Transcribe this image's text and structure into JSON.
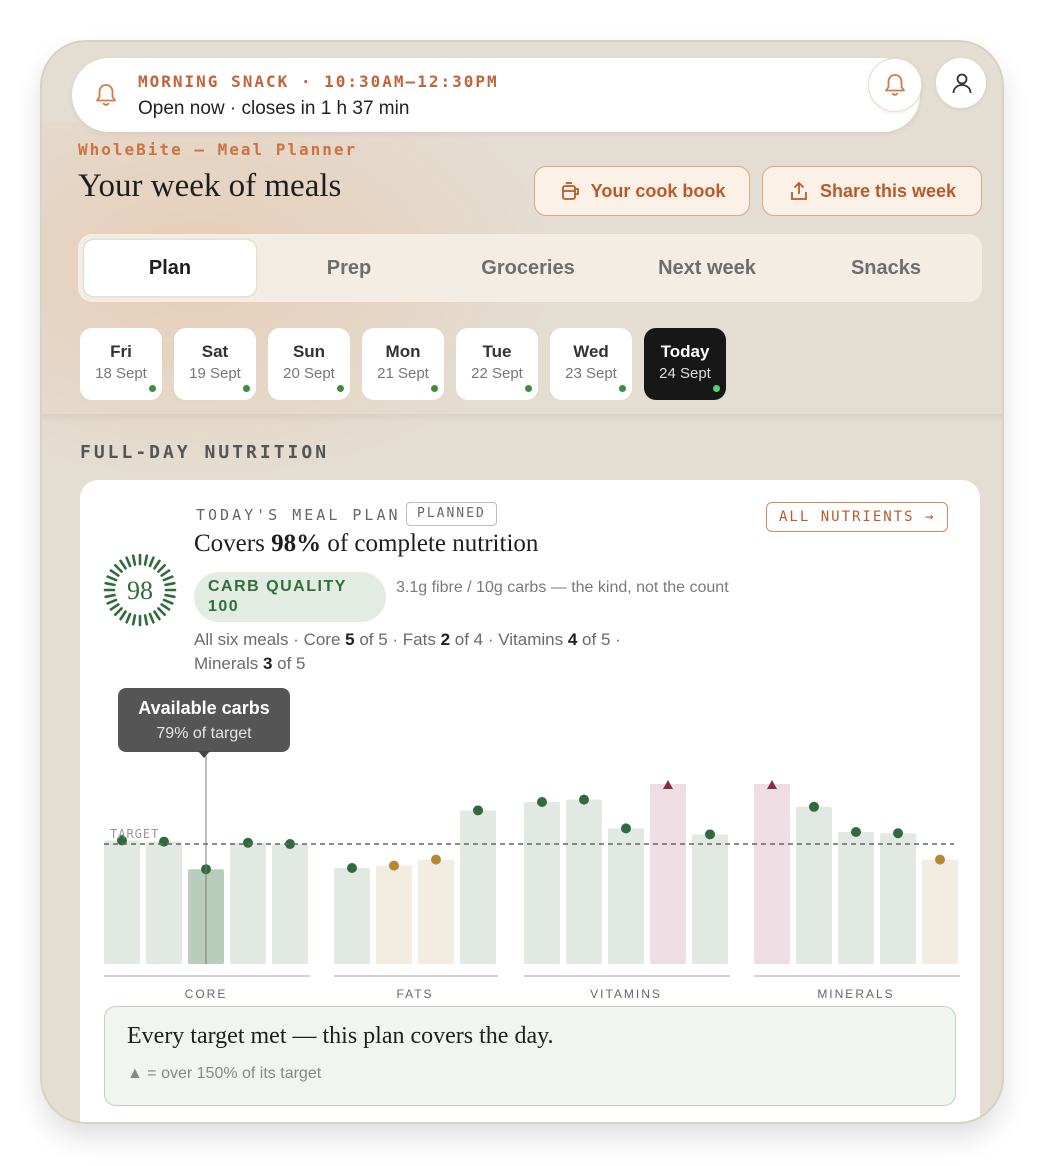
{
  "notification": {
    "title": "MORNING SNACK · 10:30AM–12:30PM",
    "subtitle": "Open now · closes in 1 h 37 min"
  },
  "header": {
    "brand": "WholeBite — Meal Planner",
    "title": "Your week of meals",
    "cookbook_label": "Your cook book",
    "share_label": "Share this week"
  },
  "tabs": [
    {
      "label": "Plan",
      "active": true
    },
    {
      "label": "Prep"
    },
    {
      "label": "Groceries"
    },
    {
      "label": "Next week"
    },
    {
      "label": "Snacks"
    }
  ],
  "days": [
    {
      "name": "Fri",
      "date": "18 Sept"
    },
    {
      "name": "Sat",
      "date": "19 Sept"
    },
    {
      "name": "Sun",
      "date": "20 Sept"
    },
    {
      "name": "Mon",
      "date": "21 Sept"
    },
    {
      "name": "Tue",
      "date": "22 Sept"
    },
    {
      "name": "Wed",
      "date": "23 Sept"
    },
    {
      "name": "Today",
      "date": "24 Sept",
      "active": true
    }
  ],
  "nutrition": {
    "section_label": "FULL-DAY NUTRITION",
    "kicker": "TODAY'S MEAL PLAN",
    "badge": "PLANNED",
    "all_nutrients_label": "ALL NUTRIENTS →",
    "covers_prefix": "Covers ",
    "covers_value": "98%",
    "covers_suffix": " of complete nutrition",
    "score": "98",
    "carb_quality_label": "CARB QUALITY",
    "carb_quality_value": "100",
    "carb_note": "3.1g fibre / 10g carbs — the kind, not the count",
    "summary": {
      "p1": "All six meals · Core ",
      "core": "5",
      "p2": " of 5 · Fats ",
      "fats": "2",
      "p3": " of 4 · Vitamins ",
      "vitamins": "4",
      "p4": " of 5 · ",
      "p5": "Minerals ",
      "minerals": "3",
      "p6": " of 5"
    },
    "tooltip": {
      "title": "Available carbs",
      "value": "79% of target"
    },
    "verdict": "Every target met — this plan covers the day.",
    "legend_note": "▲ = over 150% of its target"
  },
  "colors": {
    "met": "#e1e9e2",
    "met_dot": "#2f6b3c",
    "under": "#f3ece1",
    "under_dot": "#b8862e",
    "over": "#eedde2",
    "over_mark": "#8a2d3c",
    "highlight": "#b9cdbc"
  },
  "chart_data": {
    "type": "bar",
    "target_label": "TARGET",
    "target": 100,
    "groups": [
      {
        "name": "CORE",
        "values": [
          103,
          102,
          79,
          101,
          100
        ],
        "status": [
          "met",
          "met",
          "met",
          "met",
          "met"
        ],
        "highlight_index": 2
      },
      {
        "name": "FATS",
        "values": [
          80,
          82,
          87,
          128
        ],
        "status": [
          "met",
          "under",
          "under",
          "met"
        ]
      },
      {
        "name": "VITAMINS",
        "values": [
          135,
          137,
          113,
          150,
          108
        ],
        "status": [
          "met",
          "met",
          "met",
          "over",
          "met"
        ]
      },
      {
        "name": "MINERALS",
        "values": [
          150,
          131,
          110,
          109,
          87
        ],
        "status": [
          "over",
          "met",
          "met",
          "met",
          "under"
        ]
      }
    ]
  }
}
